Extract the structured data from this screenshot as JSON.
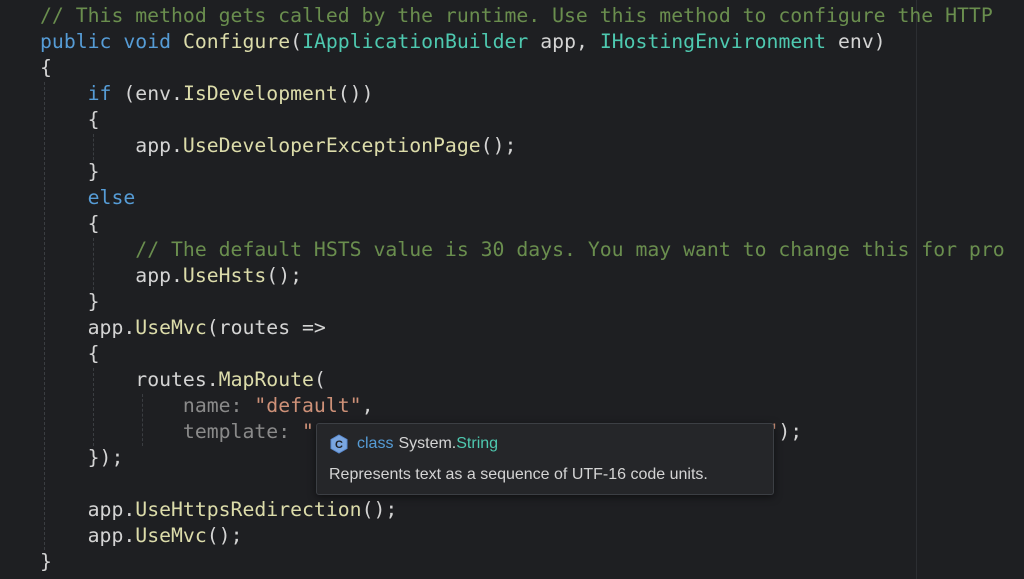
{
  "editor": {
    "lines": [
      {
        "indent": "",
        "tokens": [
          {
            "c": "cm",
            "t": "// This method gets called by the runtime. Use this method to configure the HTTP"
          }
        ]
      },
      {
        "indent": "",
        "tokens": [
          {
            "c": "kw",
            "t": "public"
          },
          {
            "c": "plain",
            "t": " "
          },
          {
            "c": "kw",
            "t": "void"
          },
          {
            "c": "plain",
            "t": " "
          },
          {
            "c": "fn",
            "t": "Configure"
          },
          {
            "c": "plain",
            "t": "("
          },
          {
            "c": "ty",
            "t": "IApplicationBuilder"
          },
          {
            "c": "plain",
            "t": " app, "
          },
          {
            "c": "ty",
            "t": "IHostingEnvironment"
          },
          {
            "c": "plain",
            "t": " env)"
          }
        ]
      },
      {
        "indent": "",
        "tokens": [
          {
            "c": "plain",
            "t": "{"
          }
        ]
      },
      {
        "indent": "    ",
        "tokens": [
          {
            "c": "kw",
            "t": "if"
          },
          {
            "c": "plain",
            "t": " (env."
          },
          {
            "c": "fn",
            "t": "IsDevelopment"
          },
          {
            "c": "plain",
            "t": "())"
          }
        ]
      },
      {
        "indent": "    ",
        "tokens": [
          {
            "c": "plain",
            "t": "{"
          }
        ]
      },
      {
        "indent": "        ",
        "tokens": [
          {
            "c": "plain",
            "t": "app."
          },
          {
            "c": "fn",
            "t": "UseDeveloperExceptionPage"
          },
          {
            "c": "plain",
            "t": "();"
          }
        ]
      },
      {
        "indent": "    ",
        "tokens": [
          {
            "c": "plain",
            "t": "}"
          }
        ]
      },
      {
        "indent": "    ",
        "tokens": [
          {
            "c": "kw",
            "t": "else"
          }
        ]
      },
      {
        "indent": "    ",
        "tokens": [
          {
            "c": "plain",
            "t": "{"
          }
        ]
      },
      {
        "indent": "        ",
        "tokens": [
          {
            "c": "cm",
            "t": "// The default HSTS value is 30 days. You may want to change this for pro"
          }
        ]
      },
      {
        "indent": "        ",
        "tokens": [
          {
            "c": "plain",
            "t": "app."
          },
          {
            "c": "fn",
            "t": "UseHsts"
          },
          {
            "c": "plain",
            "t": "();"
          }
        ]
      },
      {
        "indent": "    ",
        "tokens": [
          {
            "c": "plain",
            "t": "}"
          }
        ]
      },
      {
        "indent": "    ",
        "tokens": [
          {
            "c": "plain",
            "t": "app."
          },
          {
            "c": "fn",
            "t": "UseMvc"
          },
          {
            "c": "plain",
            "t": "(routes =>"
          }
        ]
      },
      {
        "indent": "    ",
        "tokens": [
          {
            "c": "plain",
            "t": "{"
          }
        ]
      },
      {
        "indent": "        ",
        "tokens": [
          {
            "c": "plain",
            "t": "routes."
          },
          {
            "c": "fn",
            "t": "MapRoute"
          },
          {
            "c": "plain",
            "t": "("
          }
        ]
      },
      {
        "indent": "            ",
        "tokens": [
          {
            "c": "param",
            "t": "name: "
          },
          {
            "c": "str",
            "t": "\"default\""
          },
          {
            "c": "plain",
            "t": ","
          }
        ]
      },
      {
        "indent": "            ",
        "tokens": [
          {
            "c": "param",
            "t": "template: "
          },
          {
            "c": "str",
            "t": "\"                                     }\""
          },
          {
            "c": "plain",
            "t": ");"
          }
        ]
      },
      {
        "indent": "    ",
        "tokens": [
          {
            "c": "plain",
            "t": "});"
          }
        ]
      },
      {
        "indent": "",
        "tokens": [
          {
            "c": "plain",
            "t": ""
          }
        ]
      },
      {
        "indent": "    ",
        "tokens": [
          {
            "c": "plain",
            "t": "app."
          },
          {
            "c": "fn",
            "t": "UseHttpsRedirection"
          },
          {
            "c": "plain",
            "t": "();"
          }
        ]
      },
      {
        "indent": "    ",
        "tokens": [
          {
            "c": "plain",
            "t": "app."
          },
          {
            "c": "fn",
            "t": "UseMvc"
          },
          {
            "c": "plain",
            "t": "();"
          }
        ]
      },
      {
        "indent": "",
        "tokens": [
          {
            "c": "plain",
            "t": "}"
          }
        ]
      }
    ]
  },
  "tooltip": {
    "icon": "class-icon",
    "keyword": "class",
    "namespace": "System.",
    "type_name": "String",
    "description": "Represents text as a sequence of UTF-16 code units."
  },
  "colors": {
    "background": "#1e1f22",
    "keyword": "#569cd6",
    "type": "#4ec9b0",
    "string": "#ce9178",
    "comment": "#6a8e4e",
    "function": "#dcdcaa",
    "tooltip_bg": "#252629"
  }
}
